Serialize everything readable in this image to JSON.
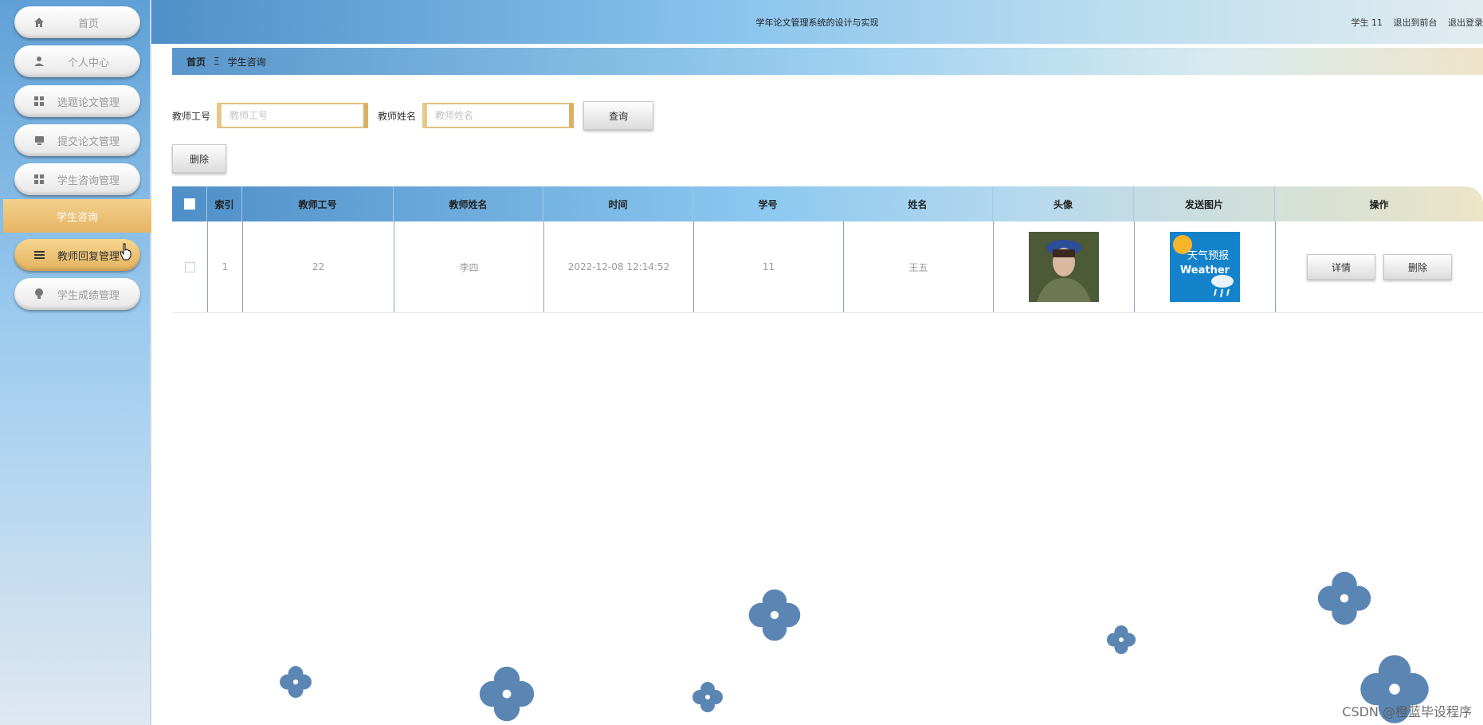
{
  "sidebar": {
    "items": [
      {
        "label": "首页",
        "icon": "home-icon"
      },
      {
        "label": "个人中心",
        "icon": "user-icon"
      },
      {
        "label": "选题论文管理",
        "icon": "grid-icon"
      },
      {
        "label": "提交论文管理",
        "icon": "monitor-icon"
      },
      {
        "label": "学生咨询管理",
        "icon": "grid-icon"
      },
      {
        "label": "教师回复管理",
        "icon": "list-icon"
      },
      {
        "label": "学生成绩管理",
        "icon": "bulb-icon"
      }
    ],
    "submenu": {
      "label": "学生咨询"
    },
    "active_color": "#e6b565"
  },
  "header": {
    "title": "学年论文管理系统的设计与实现",
    "user": "学生 11",
    "to_frontend": "退出到前台",
    "logout": "退出登录"
  },
  "breadcrumb": {
    "home": "首页",
    "separator": "Ξ",
    "current": "学生咨询"
  },
  "search": {
    "teacher_id_label": "教师工号",
    "teacher_id_placeholder": "教师工号",
    "teacher_name_label": "教师姓名",
    "teacher_name_placeholder": "教师姓名",
    "query_label": "查询"
  },
  "toolbar": {
    "delete_label": "删除"
  },
  "table": {
    "headers": [
      "索引",
      "教师工号",
      "教师姓名",
      "时间",
      "学号",
      "姓名",
      "头像",
      "发送图片",
      "操作"
    ],
    "rows": [
      {
        "index": "1",
        "teacher_id": "22",
        "teacher_name": "李四",
        "time": "2022-12-08 12:14:52",
        "student_id": "11",
        "name": "王五"
      }
    ],
    "detail_label": "详情",
    "delete_label": "删除"
  },
  "weather_image": {
    "text_cn": "天气预报",
    "text_en": "Weather"
  },
  "watermark": "CSDN @橙蓝毕设程序"
}
